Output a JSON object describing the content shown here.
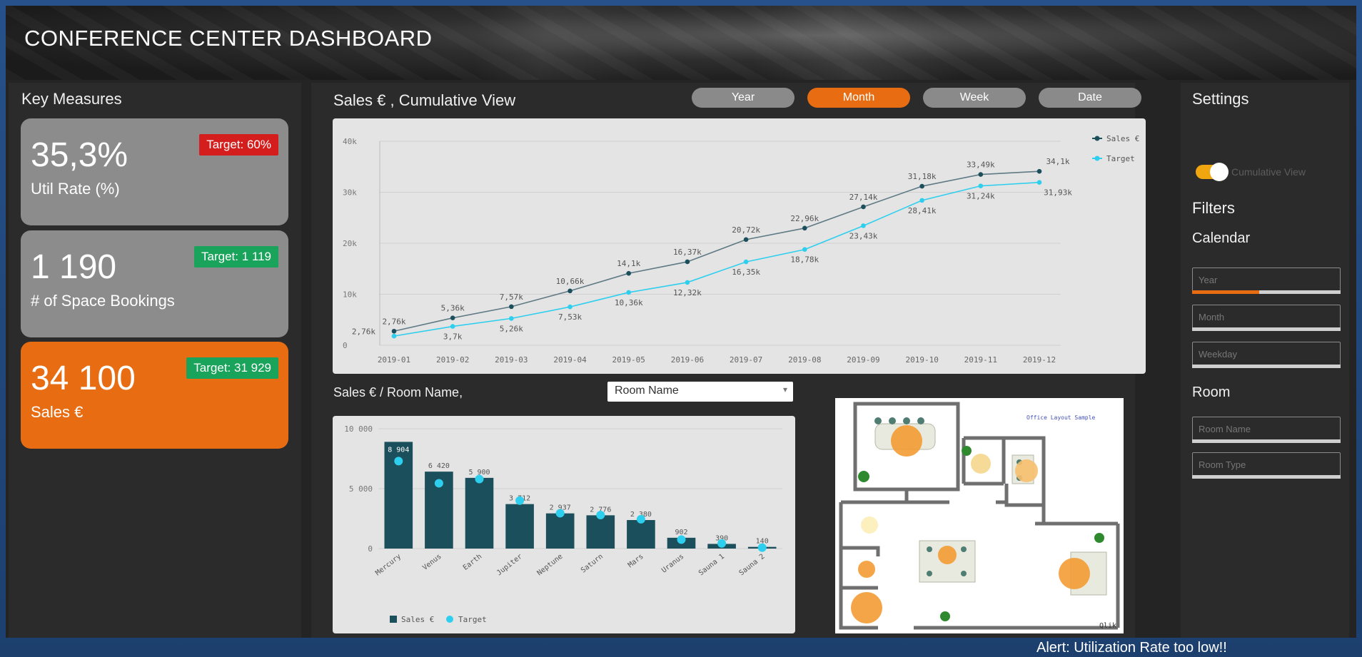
{
  "header": {
    "title": "CONFERENCE CENTER DASHBOARD"
  },
  "key_measures": {
    "title": "Key Measures",
    "cards": [
      {
        "value": "35,3%",
        "label": "Util Rate (%)",
        "target": "Target: 60%",
        "target_status": "red"
      },
      {
        "value": "1 190",
        "label": "# of Space Bookings",
        "target": "Target: 1 119",
        "target_status": "green"
      },
      {
        "value": "34 100",
        "label": "Sales €",
        "target": "Target: 31 929",
        "target_status": "green"
      }
    ]
  },
  "sales_panel": {
    "title": "Sales € , Cumulative View",
    "period_buttons": [
      "Year",
      "Month",
      "Week",
      "Date"
    ],
    "active_period": "Month"
  },
  "room_panel": {
    "title": "Sales € / Room Name,",
    "dropdown_value": "Room Name"
  },
  "layout_image": {
    "caption": "Office Layout Sample",
    "stamp": "Qlik"
  },
  "settings": {
    "title": "Settings",
    "toggle_label": "Cumulative View",
    "filters_title": "Filters",
    "calendar_title": "Calendar",
    "calendar_fields": [
      "Year",
      "Month",
      "Weekday"
    ],
    "year_selection_fraction": 0.45,
    "room_title": "Room",
    "room_fields": [
      "Room Name",
      "Room Type"
    ]
  },
  "alert": "Alert: Utilization Rate too low!!",
  "colors": {
    "accent_orange": "#e86c12",
    "sales_series": "#1c4f5c",
    "target_series": "#2ecfee",
    "target_bad": "#d41d1d",
    "target_good": "#1aa35a"
  },
  "chart_data": [
    {
      "type": "line",
      "x": [
        "2019-01",
        "2019-02",
        "2019-03",
        "2019-04",
        "2019-05",
        "2019-06",
        "2019-07",
        "2019-08",
        "2019-09",
        "2019-10",
        "2019-11",
        "2019-12"
      ],
      "y_ticks": [
        "0",
        "10k",
        "20k",
        "30k",
        "40k"
      ],
      "ylim": [
        0,
        40000
      ],
      "grid": true,
      "legend": "top-right",
      "series": [
        {
          "name": "Sales €",
          "values": [
            2760,
            5360,
            7570,
            10660,
            14100,
            16370,
            20720,
            22960,
            27140,
            31180,
            33490,
            34100
          ],
          "labels": [
            "2,76k",
            "5,36k",
            "7,57k",
            "10,66k",
            "14,1k",
            "16,37k",
            "20,72k",
            "22,96k",
            "27,14k",
            "31,18k",
            "33,49k",
            "34,1k"
          ]
        },
        {
          "name": "Target",
          "values": [
            1800,
            3700,
            5260,
            7530,
            10360,
            12320,
            16350,
            18780,
            23430,
            28410,
            31240,
            31930
          ],
          "labels": [
            "",
            "3,7k",
            "5,26k",
            "7,53k",
            "10,36k",
            "12,32k",
            "16,35k",
            "18,78k",
            "23,43k",
            "28,41k",
            "31,24k",
            "31,93k"
          ]
        }
      ]
    },
    {
      "type": "bar",
      "categories": [
        "Mercury",
        "Venus",
        "Earth",
        "Jupiter",
        "Neptune",
        "Saturn",
        "Mars",
        "Uranus",
        "Sauna 1",
        "Sauna 2"
      ],
      "y_ticks": [
        "0",
        "5 000",
        "10 000"
      ],
      "ylim": [
        0,
        10000
      ],
      "grid": true,
      "legend": "bottom-left",
      "series": [
        {
          "name": "Sales €",
          "values": [
            8904,
            6420,
            5900,
            3712,
            2937,
            2776,
            2380,
            902,
            390,
            140
          ],
          "labels": [
            "8 904",
            "6 420",
            "5 900",
            "3 712",
            "2 937",
            "2 776",
            "2 380",
            "902",
            "390",
            "140"
          ]
        },
        {
          "name": "Target",
          "values": [
            7300,
            5450,
            5800,
            4000,
            2950,
            2800,
            2450,
            750,
            430,
            80
          ]
        }
      ]
    }
  ]
}
